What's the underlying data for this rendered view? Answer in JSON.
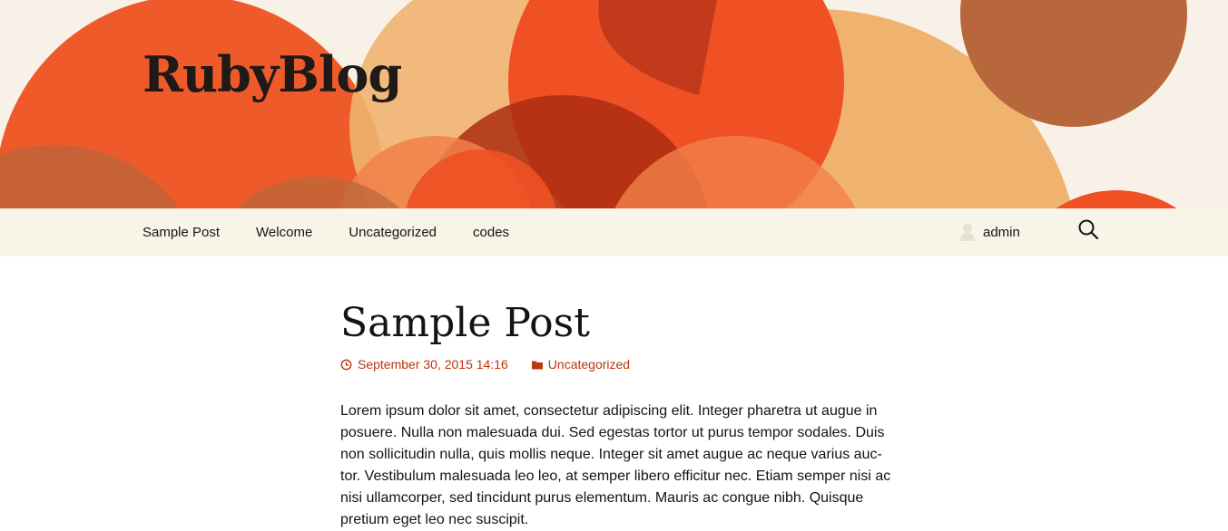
{
  "header": {
    "site_title": "RubyBlog"
  },
  "nav": {
    "links": [
      "Sample Post",
      "Welcome",
      "Uncategorized",
      "codes"
    ],
    "user_name": "admin",
    "search_icon": "search-icon"
  },
  "post": {
    "title": "Sample Post",
    "date": "September 30, 2015 14:16",
    "category": "Uncategorized",
    "body": "Lorem ipsum dolor sit amet, consectetur adipiscing elit. Integer pharetra ut augue in posuere. Nulla non malesuada dui. Sed egestas tortor ut purus tempor sodales. Duis non sollicitudin nulla, quis mollis neque. Integer sit amet augue ac neque varius auc-tor. Vestibulum malesuada leo leo, at semper libero efficitur nec. Etiam semper nisi ac nisi ullamcorper, sed tincidunt purus elementum. Mauris ac congue nibh. Quisque pretium eget leo nec suscipit."
  },
  "colors": {
    "accent": "#bc360a",
    "nav_background": "#f7f5e7",
    "header_background": "#f8f1e7"
  }
}
